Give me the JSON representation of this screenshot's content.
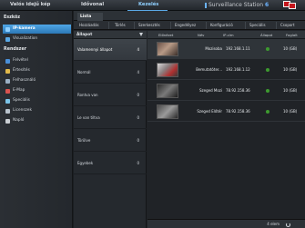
{
  "topbar": {
    "tabs": [
      {
        "label": "Valós idejű kép"
      },
      {
        "label": "Idővonal"
      },
      {
        "label": "Kezelés"
      }
    ],
    "brand": "Surveillance Station",
    "brand_version": "6"
  },
  "sidebar": {
    "section1": "Eszköz",
    "items1": [
      {
        "label": "IP-kamera",
        "icon": "camera-icon"
      },
      {
        "label": "Visualization",
        "icon": "visualization-icon"
      }
    ],
    "section2": "Rendszer",
    "items2": [
      {
        "label": "Felvétel",
        "icon": "recording-icon"
      },
      {
        "label": "Értesítés",
        "icon": "notification-icon"
      },
      {
        "label": "Felhasználó",
        "icon": "user-icon"
      },
      {
        "label": "E-Map",
        "icon": "emap-icon"
      },
      {
        "label": "Speciális",
        "icon": "advanced-icon"
      },
      {
        "label": "Licenszek",
        "icon": "license-icon"
      },
      {
        "label": "Napló",
        "icon": "log-icon"
      }
    ]
  },
  "main": {
    "tab": "Lista",
    "toolbar": [
      "Hozzáadás",
      "Törlés",
      "Szerkesztés",
      "Engedélyez",
      "Konfiguráció",
      "Speciális",
      "Csoport"
    ],
    "status_header": "Állapot",
    "statuses": [
      {
        "label": "Valamennyi állapot",
        "count": "4"
      },
      {
        "label": "Normál",
        "count": "4"
      },
      {
        "label": "Rontva van",
        "count": "0"
      },
      {
        "label": "Le van tiltva",
        "count": "0"
      },
      {
        "label": "Törölve",
        "count": "0"
      },
      {
        "label": "Egyebek",
        "count": "0"
      }
    ],
    "columns": [
      "Előnézet",
      "Név",
      "IP-cím",
      "Állapot",
      "Foglalt"
    ],
    "cameras": [
      {
        "name": "Mozisoba",
        "ip": "192.168.1.11",
        "size": "10 (GB)"
      },
      {
        "name": "Bemutatóter...",
        "ip": "192.168.1.12",
        "size": "10 (GB)"
      },
      {
        "name": "Szeged Mozi",
        "ip": "78.92.158.36",
        "size": "10 (GB)"
      },
      {
        "name": "Szeged Előtér",
        "ip": "78.92.158.36",
        "size": "10 (GB)"
      }
    ],
    "footer": "4 elem"
  }
}
